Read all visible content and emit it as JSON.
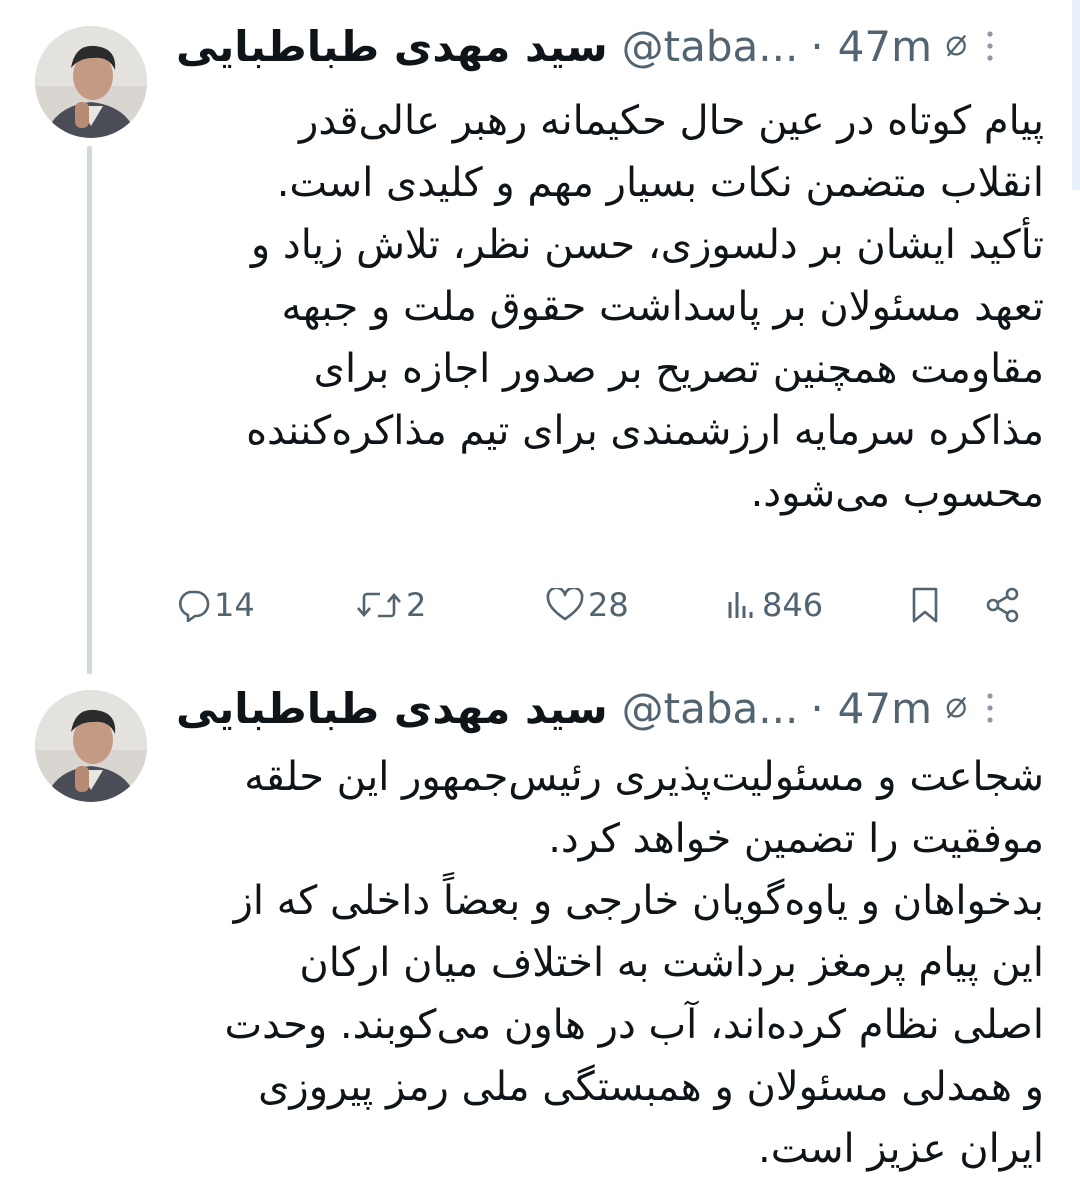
{
  "posts": [
    {
      "author_name": "سید مهدی طباطبایی",
      "handle": "@taba...",
      "separator": "·",
      "time": "47m",
      "icons": {
        "avatar": "author-avatar",
        "status": "slashed-circle-icon",
        "more": "more-vertical-icon"
      },
      "body_lines": [
        "پیام کوتاه در عین حال حکیمانه رهبر عالی‌قدر",
        "انقلاب متضمن نکات بسیار مهم و کلیدی است.",
        "تأکید ایشان بر دلسوزی، حسن نظر، تلاش زیاد و",
        "تعهد مسئولان بر پاسداشت حقوق ملت و جبهه",
        "مقاومت همچنین تصریح بر صدور اجازه برای",
        "مذاکره سرمایه ارزشمندی برای تیم مذاکره‌کننده",
        "محسوب می‌شود."
      ],
      "stats": {
        "replies": "14",
        "reposts": "2",
        "likes": "28",
        "views": "846"
      }
    },
    {
      "author_name": "سید مهدی طباطبایی",
      "handle": "@taba...",
      "separator": "·",
      "time": "47m",
      "icons": {
        "avatar": "author-avatar",
        "status": "slashed-circle-icon",
        "more": "more-vertical-icon"
      },
      "body_lines": [
        "شجاعت و مسئولیت‌پذیری رئیس‌جمهور این حلقه",
        "موفقیت را تضمین خواهد کرد.",
        "بدخواهان و یاوه‌گویان خارجی و بعضاً داخلی که از",
        "این پیام پرمغز برداشت به اختلاف میان ارکان",
        "اصلی نظام کرده‌اند، آب در هاون می‌کوبند. وحدت",
        "و همدلی مسئولان و همبستگی ملی رمز پیروزی",
        "ایران عزیز است."
      ]
    }
  ],
  "colors": {
    "text": "#0f1419",
    "secondary": "#536471",
    "thread_line": "#cfd9de"
  }
}
